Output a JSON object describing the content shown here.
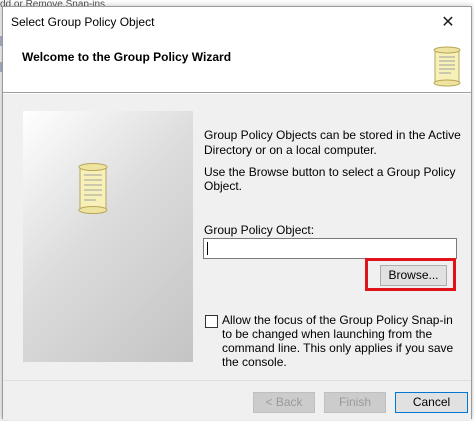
{
  "background": {
    "partial_text": "dd or Remove Snap-ins"
  },
  "window": {
    "title": "Select Group Policy Object",
    "header_title": "Welcome to the Group Policy Wizard"
  },
  "body": {
    "info_text": "Group Policy Objects can be stored in the Active Directory or on a local computer.",
    "browse_hint": "Use the Browse button to select a Group Policy Object.",
    "gpo_label": "Group Policy Object:",
    "gpo_value": "",
    "browse_label": "Browse...",
    "checkbox_checked": false,
    "checkbox_label": "Allow the focus of the Group Policy Snap-in to be changed when launching from the command line.  This only applies if you save the console."
  },
  "footer": {
    "back_label": "< Back",
    "finish_label": "Finish",
    "cancel_label": "Cancel"
  },
  "colors": {
    "highlight": "#e0121a",
    "scroll_paper": "#f7f0b8"
  },
  "icons": {
    "header": "scroll-icon",
    "side": "scroll-icon",
    "close": "close-icon"
  }
}
